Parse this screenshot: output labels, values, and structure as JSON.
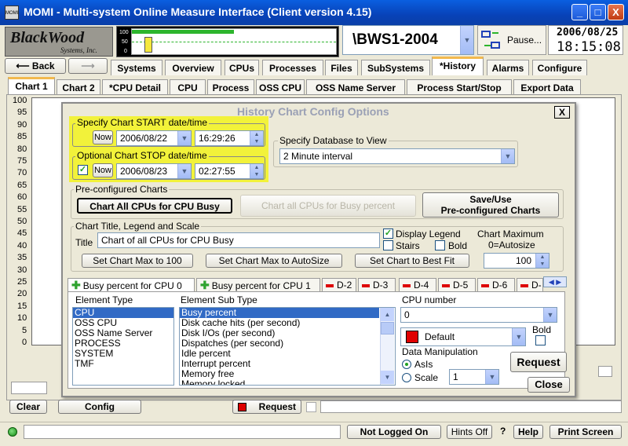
{
  "window": {
    "title": "MOMI - Multi-system Online Measure Interface (Client version 4.15)",
    "icon": "MOMI",
    "min": "_",
    "max": "□",
    "close": "X"
  },
  "header": {
    "logo_main": "BlackWood",
    "logo_sub": "Systems, Inc.",
    "graph_ticks": [
      "100",
      "50",
      "0"
    ],
    "system": "\\BWS1-2004",
    "pause": "Pause...",
    "date": "2006/08/25",
    "time": "18:15:08"
  },
  "nav": {
    "back": "Back",
    "tabs": [
      "Systems",
      "Overview",
      "CPUs",
      "Processes",
      "Files",
      "SubSystems",
      "*History",
      "Alarms",
      "Configure"
    ]
  },
  "subtabs": [
    "Chart 1",
    "Chart 2",
    "*CPU Detail",
    "CPU",
    "Process",
    "OSS CPU",
    "OSS Name Server",
    "Process Start/Stop",
    "Export Data"
  ],
  "yaxis": [
    "100",
    "95",
    "90",
    "85",
    "80",
    "75",
    "70",
    "65",
    "60",
    "55",
    "50",
    "45",
    "40",
    "35",
    "30",
    "25",
    "20",
    "15",
    "10",
    "5",
    "0"
  ],
  "dialog": {
    "title": "History Chart Config Options",
    "close": "X",
    "start": {
      "label": "Specify Chart START date/time",
      "now": "Now",
      "date": "2006/08/22",
      "time": "16:29:26"
    },
    "stop": {
      "label": "Optional Chart STOP date/time",
      "now": "Now",
      "date": "2006/08/23",
      "time": "02:27:55"
    },
    "db": {
      "label": "Specify Database to View",
      "value": "2 Minute interval"
    },
    "preconf": {
      "label": "Pre-configured Charts",
      "btn1": "Chart All CPUs for CPU Busy",
      "btn2": "Chart all CPUs for Busy percent",
      "btn3a": "Save/Use",
      "btn3b": "Pre-configured Charts"
    },
    "titlegroup": {
      "label": "Chart Title, Legend and Scale",
      "title_label": "Title",
      "title_value": "Chart of all CPUs for CPU Busy",
      "display_legend": "Display Legend",
      "stairs": "Stairs",
      "bold": "Bold",
      "chart_max": "Chart Maximum",
      "autosize": "0=Autosize",
      "max_value": "100",
      "btn_max100": "Set Chart Max to 100",
      "btn_auto": "Set Chart Max to AutoSize",
      "btn_best": "Set Chart to Best Fit"
    },
    "series_tabs": [
      "Busy percent for CPU 0",
      "Busy percent for CPU 1",
      "D-2",
      "D-3",
      "D-4",
      "D-5",
      "D-6",
      "D-"
    ],
    "element_type": {
      "label": "Element Type",
      "items": [
        "CPU",
        "OSS CPU",
        "OSS Name Server",
        "PROCESS",
        "SYSTEM",
        "TMF"
      ]
    },
    "element_sub": {
      "label": "Element Sub Type",
      "items": [
        "Busy percent",
        "Disk cache hits (per second)",
        "Disk I/Os (per second)",
        "Dispatches (per second)",
        "Idle percent",
        "Interrupt percent",
        "Memory free",
        "Memory locked"
      ]
    },
    "cpu": {
      "label": "CPU number",
      "value": "0",
      "color": "Default",
      "color_hex": "#E00000",
      "bold": "Bold"
    },
    "manip": {
      "label": "Data Manipulation",
      "asis": "AsIs",
      "scale": "Scale",
      "scale_value": "1"
    },
    "request": "Request",
    "close_btn": "Close"
  },
  "bottom": {
    "clear": "Clear",
    "config": "Config",
    "request": "Request"
  },
  "status": {
    "login": "Not Logged On",
    "hints": "Hints Off",
    "help_q": "?",
    "help": "Help",
    "print": "Print Screen"
  }
}
